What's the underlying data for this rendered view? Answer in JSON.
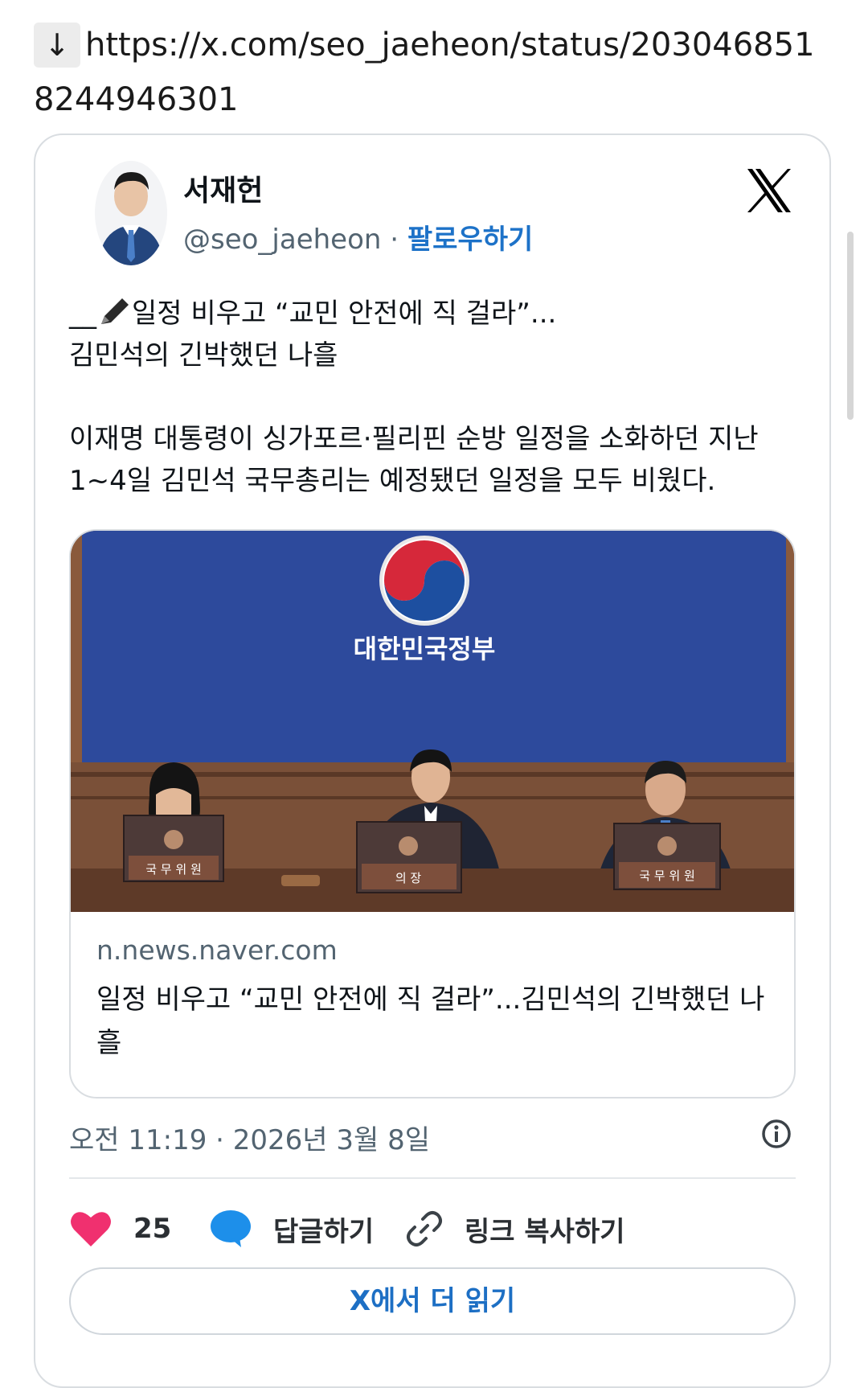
{
  "top_link": {
    "arrow": "↓",
    "url": "https://x.com/seo_jaeheon/status/2030468518244946301"
  },
  "tweet": {
    "author_name": "서재헌",
    "handle": "@seo_jaeheon",
    "separator": "·",
    "follow_label": "팔로우하기",
    "text_line1_prefix": "__",
    "text_line1": "일정 비우고 “교민 안전에 직 걸라”...",
    "text_line2": "김민석의 긴박했던 나흘",
    "body": "이재명 대통령이 싱가포르·필리핀 순방 일정을 소화하던 지난 1~4일 김민석 국무총리는 예정됐던 일정을 모두 비웠다.",
    "link_card": {
      "image_sign_text": "대한민국정부",
      "placard_left": "국 무 위 원",
      "placard_center": "의 장",
      "placard_right": "국 무 위 원",
      "domain": "n.news.naver.com",
      "title": "일정 비우고 “교민 안전에 직 걸라”...김민석의 긴박했던 나흘"
    },
    "timestamp": "오전 11:19 · 2026년 3월 8일",
    "actions": {
      "like_count": "25",
      "reply_label": "답글하기",
      "copy_link_label": "링크 복사하기"
    },
    "read_more_label": "X에서 더 읽기"
  },
  "colors": {
    "accent_blue": "#1d72c8",
    "heart": "#f0306f",
    "reply_bubble": "#1d8fea",
    "muted_text": "#536471"
  },
  "icons": [
    "down-arrow-icon",
    "x-logo-icon",
    "pen-icon",
    "info-icon",
    "heart-icon",
    "reply-bubble-icon",
    "link-icon"
  ]
}
